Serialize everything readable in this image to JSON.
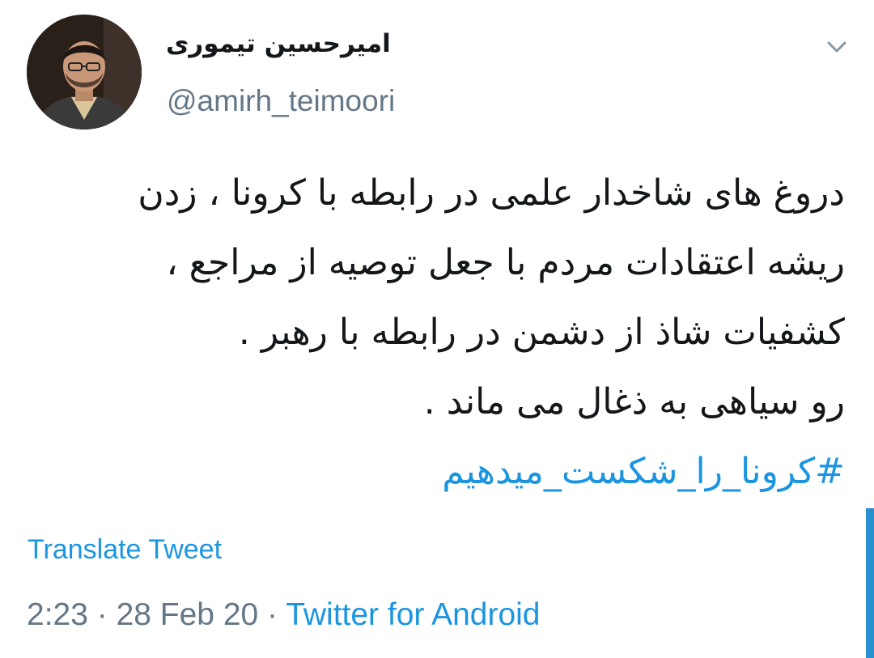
{
  "user": {
    "display_name": "امیرحسین تیموری",
    "handle": "@amirh_teimoori"
  },
  "tweet": {
    "lines": [
      "دروغ های شاخدار علمی در رابطه با کرونا ، زدن",
      "ریشه اعتقادات مردم با جعل توصیه از مراجع ،",
      "کشفیات شاذ از دشمن در رابطه با رهبر .",
      "رو سیاهی به ذغال می ماند ."
    ],
    "hashtag": "#کرونا_را_شکست_میدهیم"
  },
  "translate_label": "Translate Tweet",
  "meta": {
    "time": "2:23",
    "separator1": " · ",
    "date": "28 Feb 20",
    "separator2": " · ",
    "source": "Twitter for Android"
  },
  "icons": {
    "menu": "chevron-down-icon"
  },
  "colors": {
    "link": "#1b95e0",
    "secondary_text": "#657786",
    "primary_text": "#14171a"
  }
}
